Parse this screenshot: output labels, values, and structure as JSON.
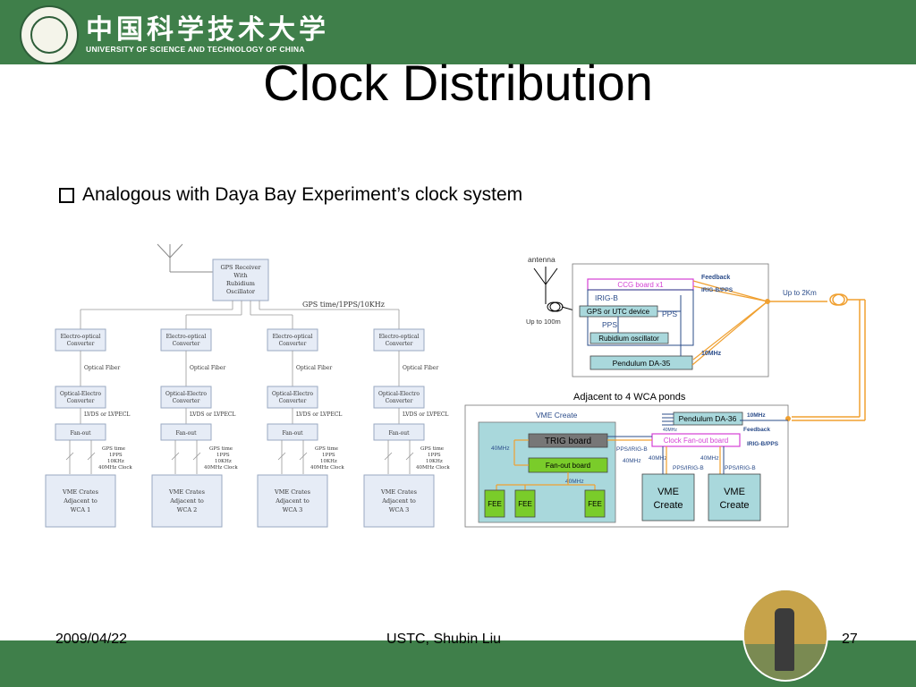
{
  "header": {
    "logo_cn": "中国科学技术大学",
    "logo_en": "UNIVERSITY OF SCIENCE AND TECHNOLOGY OF CHINA"
  },
  "slide": {
    "title": "Clock Distribution",
    "bullet": "Analogous with Daya Bay Experiment’s clock system"
  },
  "left_diagram": {
    "gps_receiver": [
      "GPS Receiver",
      "With",
      "Rubidium",
      "Oscillator"
    ],
    "gps_time_label": "GPS time/1PPS/10KHz",
    "eo": [
      "Electro-optical",
      "Converter"
    ],
    "fiber": "Optical Fiber",
    "oe": [
      "Optical-Electro",
      "Converter"
    ],
    "lvds": "LVDS or LVPECL",
    "fanout": "Fan-out",
    "clock_lines": [
      "GPS time",
      "1PPS",
      "10KHz",
      "40MHz Clock"
    ],
    "crates": [
      [
        "VME Crates",
        "Adjacent to",
        "WCA 1"
      ],
      [
        "VME Crates",
        "Adjacent to",
        "WCA 2"
      ],
      [
        "VME Crates",
        "Adjacent to",
        "WCA 3"
      ],
      [
        "VME Crates",
        "Adjacent to",
        "WCA 3"
      ]
    ]
  },
  "right_diagram": {
    "antenna": "antenna",
    "up_to_100m": "Up to 100m",
    "ccg_board": "CCG board x1",
    "irig_b": "IRIG-B",
    "gps_utc": "GPS or UTC device",
    "pps": "PPS",
    "pps2": "PPS",
    "rubidium": "Rubidium oscillator",
    "pendulum35": "Pendulum DA-35",
    "feedback": "Feedback",
    "irig_pps": "IRIG-B/PPS",
    "tenmhz": "10MHz",
    "up_to_2km": "Up to 2Km",
    "adjacent": "Adjacent to 4 WCA ponds",
    "vme_create": "VME Create",
    "pendulum36": "Pendulum DA-36",
    "tenmhz2": "10MHz",
    "feedback2": "Feedback",
    "fortymhz_small": "40MHz",
    "clock_fanout": "Clock Fan-out board",
    "irig_pps2": "IRIG-B/PPS",
    "trig": "TRIG board",
    "pps_irig": "PPS/IRIG-B",
    "fanout_board": "Fan-out board",
    "fortymhz_a": "40MHz",
    "fortymhz_b": "40MHz",
    "fortymhz_c": "40MHz",
    "fortymhz_d": "40MHz",
    "pps_irig2": "PPS/IRIG-B",
    "pps_irig3": "PPS/IRIG-B",
    "fortymhz_e": "40MHz",
    "fee": "FEE",
    "vme": "VME",
    "create": "Create"
  },
  "footer": {
    "date": "2009/04/22",
    "author": "USTC, Shubin Liu",
    "page": "27"
  }
}
